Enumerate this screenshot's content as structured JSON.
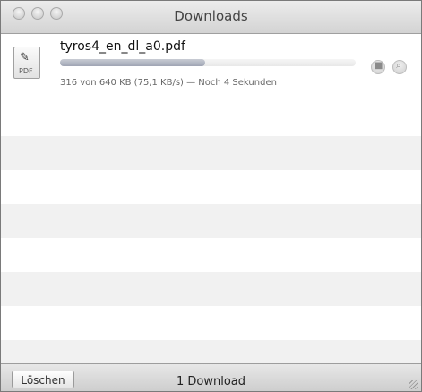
{
  "window": {
    "title": "Downloads"
  },
  "downloads": [
    {
      "file_name": "tyros4_en_dl_a0.pdf",
      "file_type_label": "PDF",
      "progress_fraction": 0.49,
      "status": "316 von 640 KB (75,1 KB/s) — Noch 4 Sekunden"
    }
  ],
  "footer": {
    "clear_button_label": "Löschen",
    "download_count_label": "1 Download"
  },
  "icons": {
    "file": "pdf-document-icon",
    "stop": "stop-download-icon",
    "reveal": "reveal-in-finder-icon"
  }
}
